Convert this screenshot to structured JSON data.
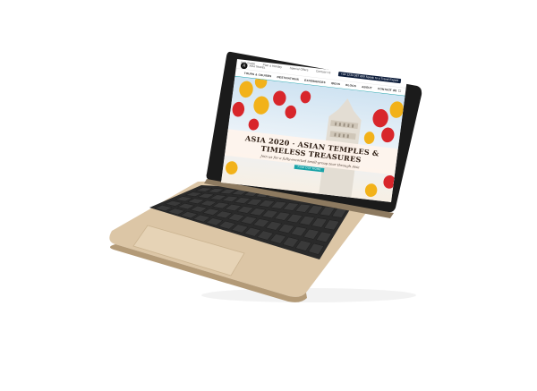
{
  "site": {
    "logo_text": "ASIA TRAVEL",
    "logo_mark": "A",
    "utility_links": [
      "Asia Guide",
      "Plan a Holiday",
      "Special Offers",
      "Contact Us"
    ],
    "phone": "+44 1234 567 890 Speak to a Travel Expert",
    "nav_items": [
      "TOURS & CRUISES",
      "DESTINATIONS",
      "EXPERIENCES",
      "IDEAS",
      "BLOGS",
      "ABOUT",
      "CONTACT US"
    ],
    "hero": {
      "headline": "ASIA 2020 · ASIAN TEMPLES & TIMELESS TREASURES",
      "subline": "Join us for a fully-escorted small-group tour through Asia",
      "cta_label": "FIND OUT MORE"
    }
  },
  "colors": {
    "accent": "#1aa3a8",
    "navy": "#0f1f3d",
    "lantern_red": "#d8262b",
    "lantern_yellow": "#f2b21a",
    "laptop_gold": "#d8c2a2",
    "laptop_bezel": "#1a1a1a"
  },
  "icons": {
    "search": "search-icon",
    "user": "user-icon",
    "cart": "bag-icon"
  }
}
